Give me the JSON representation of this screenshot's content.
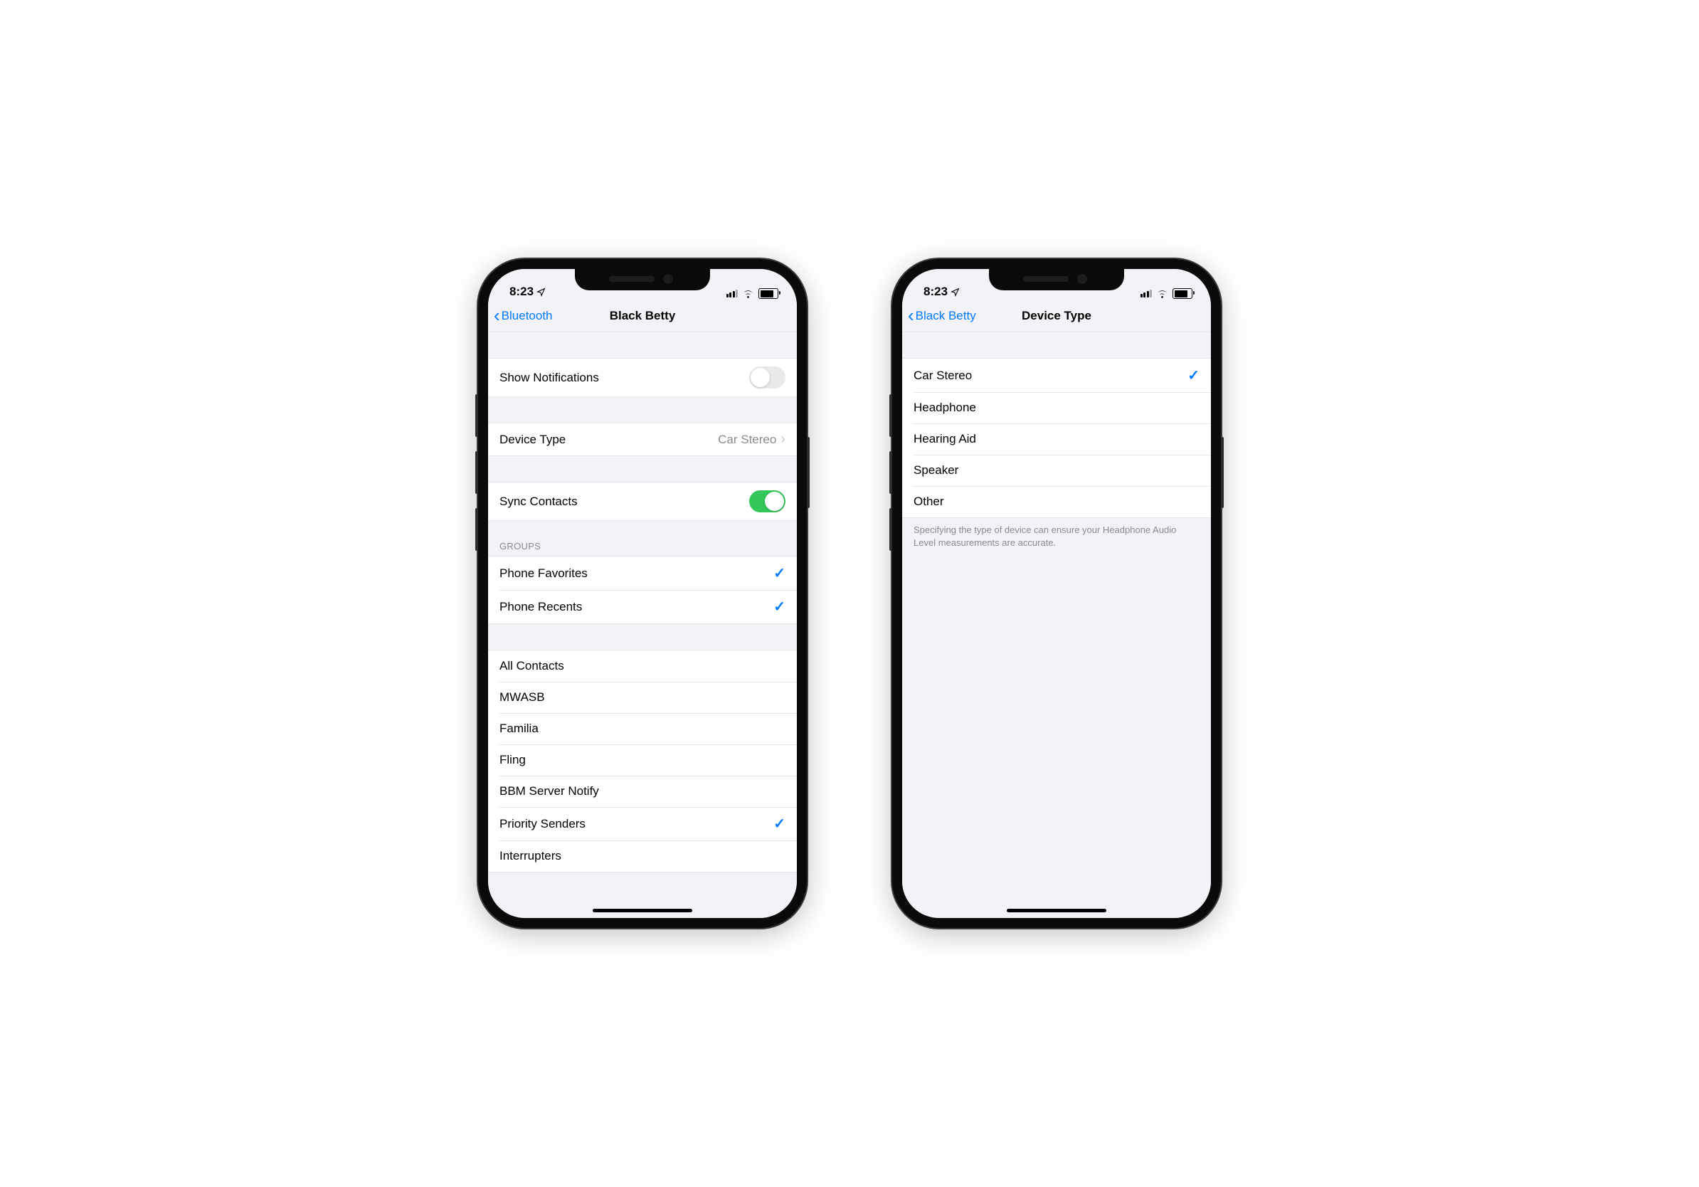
{
  "status_bar": {
    "time": "8:23"
  },
  "phone_left": {
    "nav": {
      "back_label": "Bluetooth",
      "title": "Black Betty"
    },
    "rows": {
      "show_notifications": {
        "label": "Show Notifications",
        "on": false
      },
      "device_type": {
        "label": "Device Type",
        "value": "Car Stereo"
      },
      "sync_contacts": {
        "label": "Sync Contacts",
        "on": true
      }
    },
    "groups_header": "Groups",
    "groups": [
      {
        "label": "Phone Favorites",
        "checked": true
      },
      {
        "label": "Phone Recents",
        "checked": true
      }
    ],
    "contacts": [
      {
        "label": "All Contacts",
        "checked": false
      },
      {
        "label": "MWASB",
        "checked": false
      },
      {
        "label": "Familia",
        "checked": false
      },
      {
        "label": "Fling",
        "checked": false
      },
      {
        "label": "BBM Server Notify",
        "checked": false
      },
      {
        "label": "Priority Senders",
        "checked": true
      },
      {
        "label": "Interrupters",
        "checked": false
      }
    ]
  },
  "phone_right": {
    "nav": {
      "back_label": "Black Betty",
      "title": "Device Type"
    },
    "options": [
      {
        "label": "Car Stereo",
        "checked": true
      },
      {
        "label": "Headphone",
        "checked": false
      },
      {
        "label": "Hearing Aid",
        "checked": false
      },
      {
        "label": "Speaker",
        "checked": false
      },
      {
        "label": "Other",
        "checked": false
      }
    ],
    "footer": "Specifying the type of device can ensure your Headphone Audio Level measurements are accurate."
  }
}
